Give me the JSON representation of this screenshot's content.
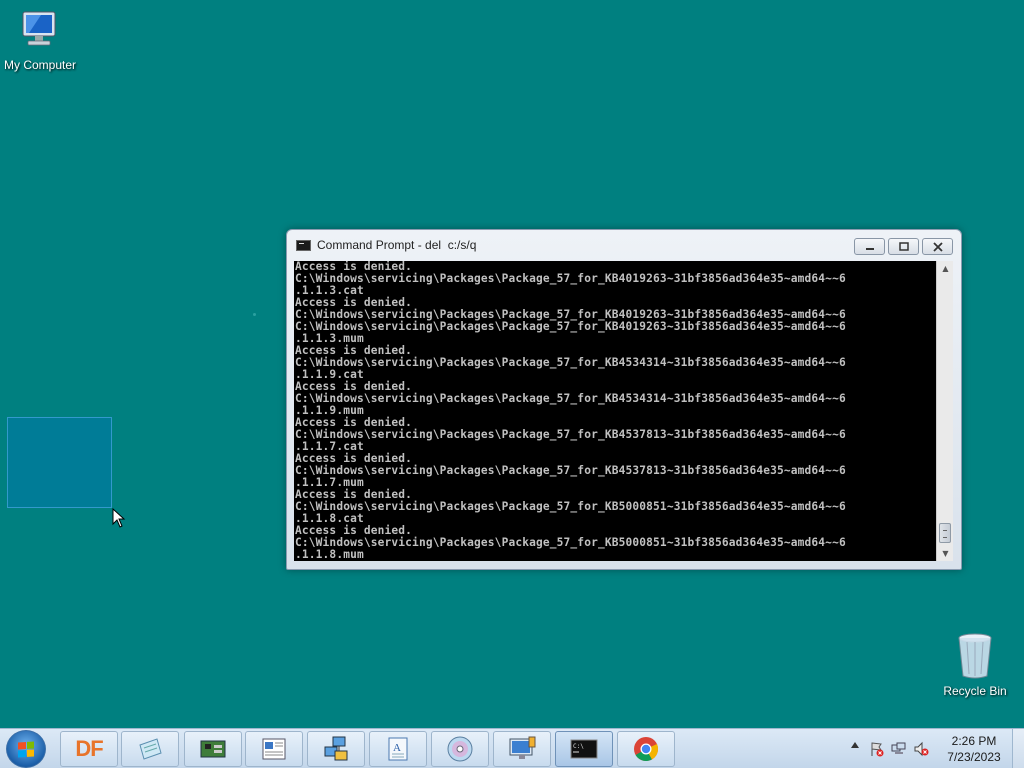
{
  "desktop": {
    "icons": [
      {
        "label": "My Computer",
        "icon": "computer-icon"
      },
      {
        "label": "Recycle Bin",
        "icon": "recycle-bin-icon"
      }
    ]
  },
  "cmd_window": {
    "title": "Command Prompt - del  c:/s/q",
    "lines": [
      "Access is denied.",
      "C:\\Windows\\servicing\\Packages\\Package_57_for_KB4019263~31bf3856ad364e35~amd64~~6",
      ".1.1.3.cat",
      "Access is denied.",
      "C:\\Windows\\servicing\\Packages\\Package_57_for_KB4019263~31bf3856ad364e35~amd64~~6",
      "C:\\Windows\\servicing\\Packages\\Package_57_for_KB4019263~31bf3856ad364e35~amd64~~6",
      ".1.1.3.mum",
      "Access is denied.",
      "C:\\Windows\\servicing\\Packages\\Package_57_for_KB4534314~31bf3856ad364e35~amd64~~6",
      ".1.1.9.cat",
      "Access is denied.",
      "C:\\Windows\\servicing\\Packages\\Package_57_for_KB4534314~31bf3856ad364e35~amd64~~6",
      ".1.1.9.mum",
      "Access is denied.",
      "C:\\Windows\\servicing\\Packages\\Package_57_for_KB4537813~31bf3856ad364e35~amd64~~6",
      ".1.1.7.cat",
      "Access is denied.",
      "C:\\Windows\\servicing\\Packages\\Package_57_for_KB4537813~31bf3856ad364e35~amd64~~6",
      ".1.1.7.mum",
      "Access is denied.",
      "C:\\Windows\\servicing\\Packages\\Package_57_for_KB5000851~31bf3856ad364e35~amd64~~6",
      ".1.1.8.cat",
      "Access is denied.",
      "C:\\Windows\\servicing\\Packages\\Package_57_for_KB5000851~31bf3856ad364e35~amd64~~6",
      ".1.1.8.mum"
    ],
    "buttons": {
      "minimize": "—",
      "maximize": "□",
      "close": "✕"
    }
  },
  "taskbar": {
    "start": "start-orb-icon",
    "apps": [
      {
        "name": "df",
        "label": "DF",
        "icon": "df-app-icon"
      },
      {
        "name": "notepad",
        "icon": "notepad-icon"
      },
      {
        "name": "device-manager",
        "icon": "circuit-board-icon"
      },
      {
        "name": "document-viewer",
        "icon": "document-icon"
      },
      {
        "name": "network",
        "icon": "network-computers-icon"
      },
      {
        "name": "wordpad",
        "icon": "wordpad-icon"
      },
      {
        "name": "media-player",
        "icon": "disc-icon"
      },
      {
        "name": "remote-desktop",
        "icon": "monitor-icon"
      },
      {
        "name": "command-prompt",
        "icon": "cmd-icon"
      },
      {
        "name": "chrome",
        "icon": "chrome-icon"
      }
    ],
    "tray": {
      "time": "2:26 PM",
      "date": "7/23/2023"
    }
  },
  "colors": {
    "desktop": "#008080",
    "selection": "#0078aa"
  }
}
